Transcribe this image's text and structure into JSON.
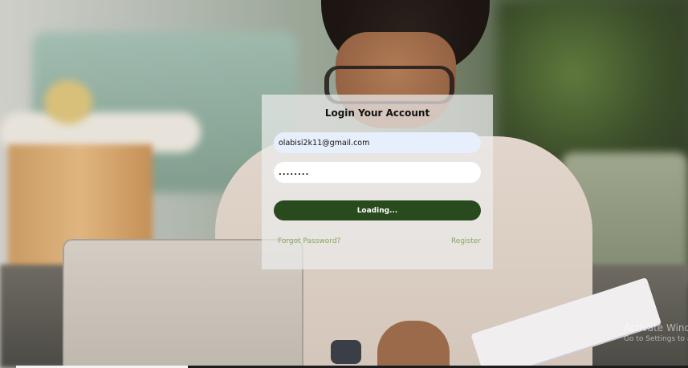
{
  "login_form": {
    "title": "Login Your Account",
    "email_value": "olabisi2k11@gmail.com",
    "password_value": "........",
    "submit_label": "Loading...",
    "forgot_password_label": "Forgot Password?",
    "register_label": "Register"
  },
  "watermark": {
    "line1": "Activate Windows",
    "line2": "Go to Settings to activate Windows."
  },
  "colors": {
    "button_bg": "#284a1c",
    "link": "#86a85a",
    "email_field_bg": "#e8effc"
  }
}
